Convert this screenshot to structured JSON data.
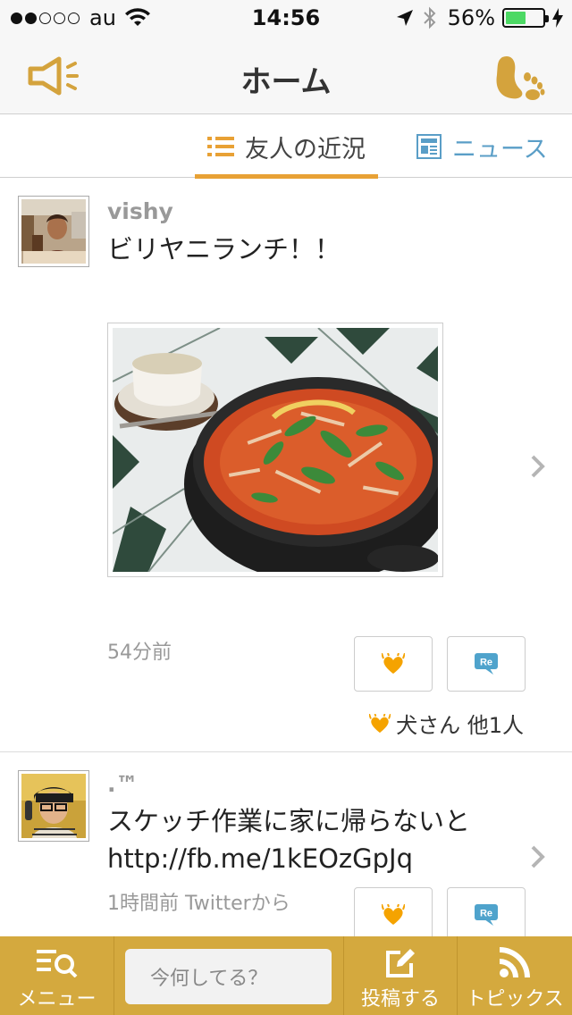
{
  "status_bar": {
    "carrier": "au",
    "time": "14:56",
    "battery": "56%",
    "battery_level": 0.56
  },
  "nav": {
    "title": "ホーム",
    "left_icon": "megaphone-icon",
    "right_icon": "footprint-icon"
  },
  "tabs": [
    {
      "label": "友人の近況",
      "icon": "list-icon",
      "active": true
    },
    {
      "label": "ニュース",
      "icon": "newspaper-icon",
      "active": false
    }
  ],
  "posts": [
    {
      "username": "vishy",
      "text": "ビリヤニランチ！！",
      "time": "54分前",
      "likes": "犬さん 他1人",
      "re_label": "Re"
    },
    {
      "username": ".™",
      "text_line1": "スケッチ作業に家に帰らないと",
      "text_line2": "http://fb.me/1kEOzGpJq",
      "time": "1時間前 Twitterから",
      "re_label": "Re"
    }
  ],
  "tabbar": {
    "menu": "メニュー",
    "compose_placeholder": "今何してる？",
    "post": "投稿する",
    "topics": "トピックス"
  },
  "colors": {
    "accent": "#e8a135",
    "tabbar": "#d4a93e",
    "news_blue": "#5a9ec7",
    "heart": "#f5a300"
  }
}
